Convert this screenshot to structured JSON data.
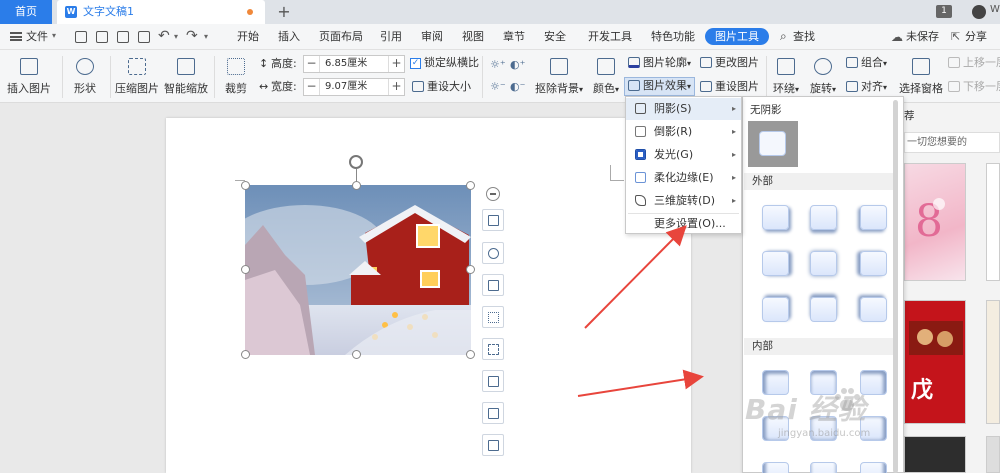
{
  "titlebar": {
    "home_label": "首页",
    "doc_tab_label": "文字文稿1",
    "new_tab_label": "+",
    "page_count": "1",
    "username": "W"
  },
  "menubar": {
    "file_label": "文件",
    "items": [
      "开始",
      "插入",
      "页面布局",
      "引用",
      "审阅",
      "视图",
      "章节",
      "安全",
      "开发工具",
      "特色功能",
      "图片工具"
    ],
    "active_index": 10,
    "search_label": "查找",
    "unsaved_label": "未保存",
    "share_label": "分享"
  },
  "ribbon": {
    "insert_picture": "插入图片",
    "shape": "形状",
    "compress": "压缩图片",
    "smart_scale": "智能缩放",
    "crop": "裁剪",
    "height_label": "高度:",
    "height_value": "6.85厘米",
    "width_label": "宽度:",
    "width_value": "9.07厘米",
    "lock_ratio": "锁定纵横比",
    "reset_size": "重设大小",
    "remove_bg": "抠除背景",
    "color": "颜色",
    "outline": "图片轮廓",
    "effects": "图片效果",
    "change_picture": "更改图片",
    "reset_picture": "重设图片",
    "wrap": "环绕",
    "rotate": "旋转",
    "group": "组合",
    "align": "对齐",
    "select_pane": "选择窗格",
    "bring_forward": "上移一层",
    "send_backward": "下移一层"
  },
  "effects_menu": {
    "items": [
      {
        "label": "阴影(S)",
        "icon": "shadow-icon",
        "has_submenu": true
      },
      {
        "label": "倒影(R)",
        "icon": "reflection-icon",
        "has_submenu": true
      },
      {
        "label": "发光(G)",
        "icon": "glow-icon",
        "has_submenu": true
      },
      {
        "label": "柔化边缘(E)",
        "icon": "soft-edge-icon",
        "has_submenu": true
      },
      {
        "label": "三维旋转(D)",
        "icon": "3d-rotate-icon",
        "has_submenu": true
      },
      {
        "label": "更多设置(O)...",
        "icon": "",
        "has_submenu": false
      }
    ],
    "highlighted_index": 0
  },
  "shadow_panel": {
    "no_shadow": "无阴影",
    "outer": "外部",
    "inner": "内部"
  },
  "right_pane": {
    "title": "荐",
    "search_placeholder": "一切您想要的"
  },
  "watermark": {
    "text": "Bai 经验",
    "url": "jingyan.baidu.com"
  },
  "colors": {
    "accent": "#2b7de9",
    "arrow": "#e8453c"
  }
}
